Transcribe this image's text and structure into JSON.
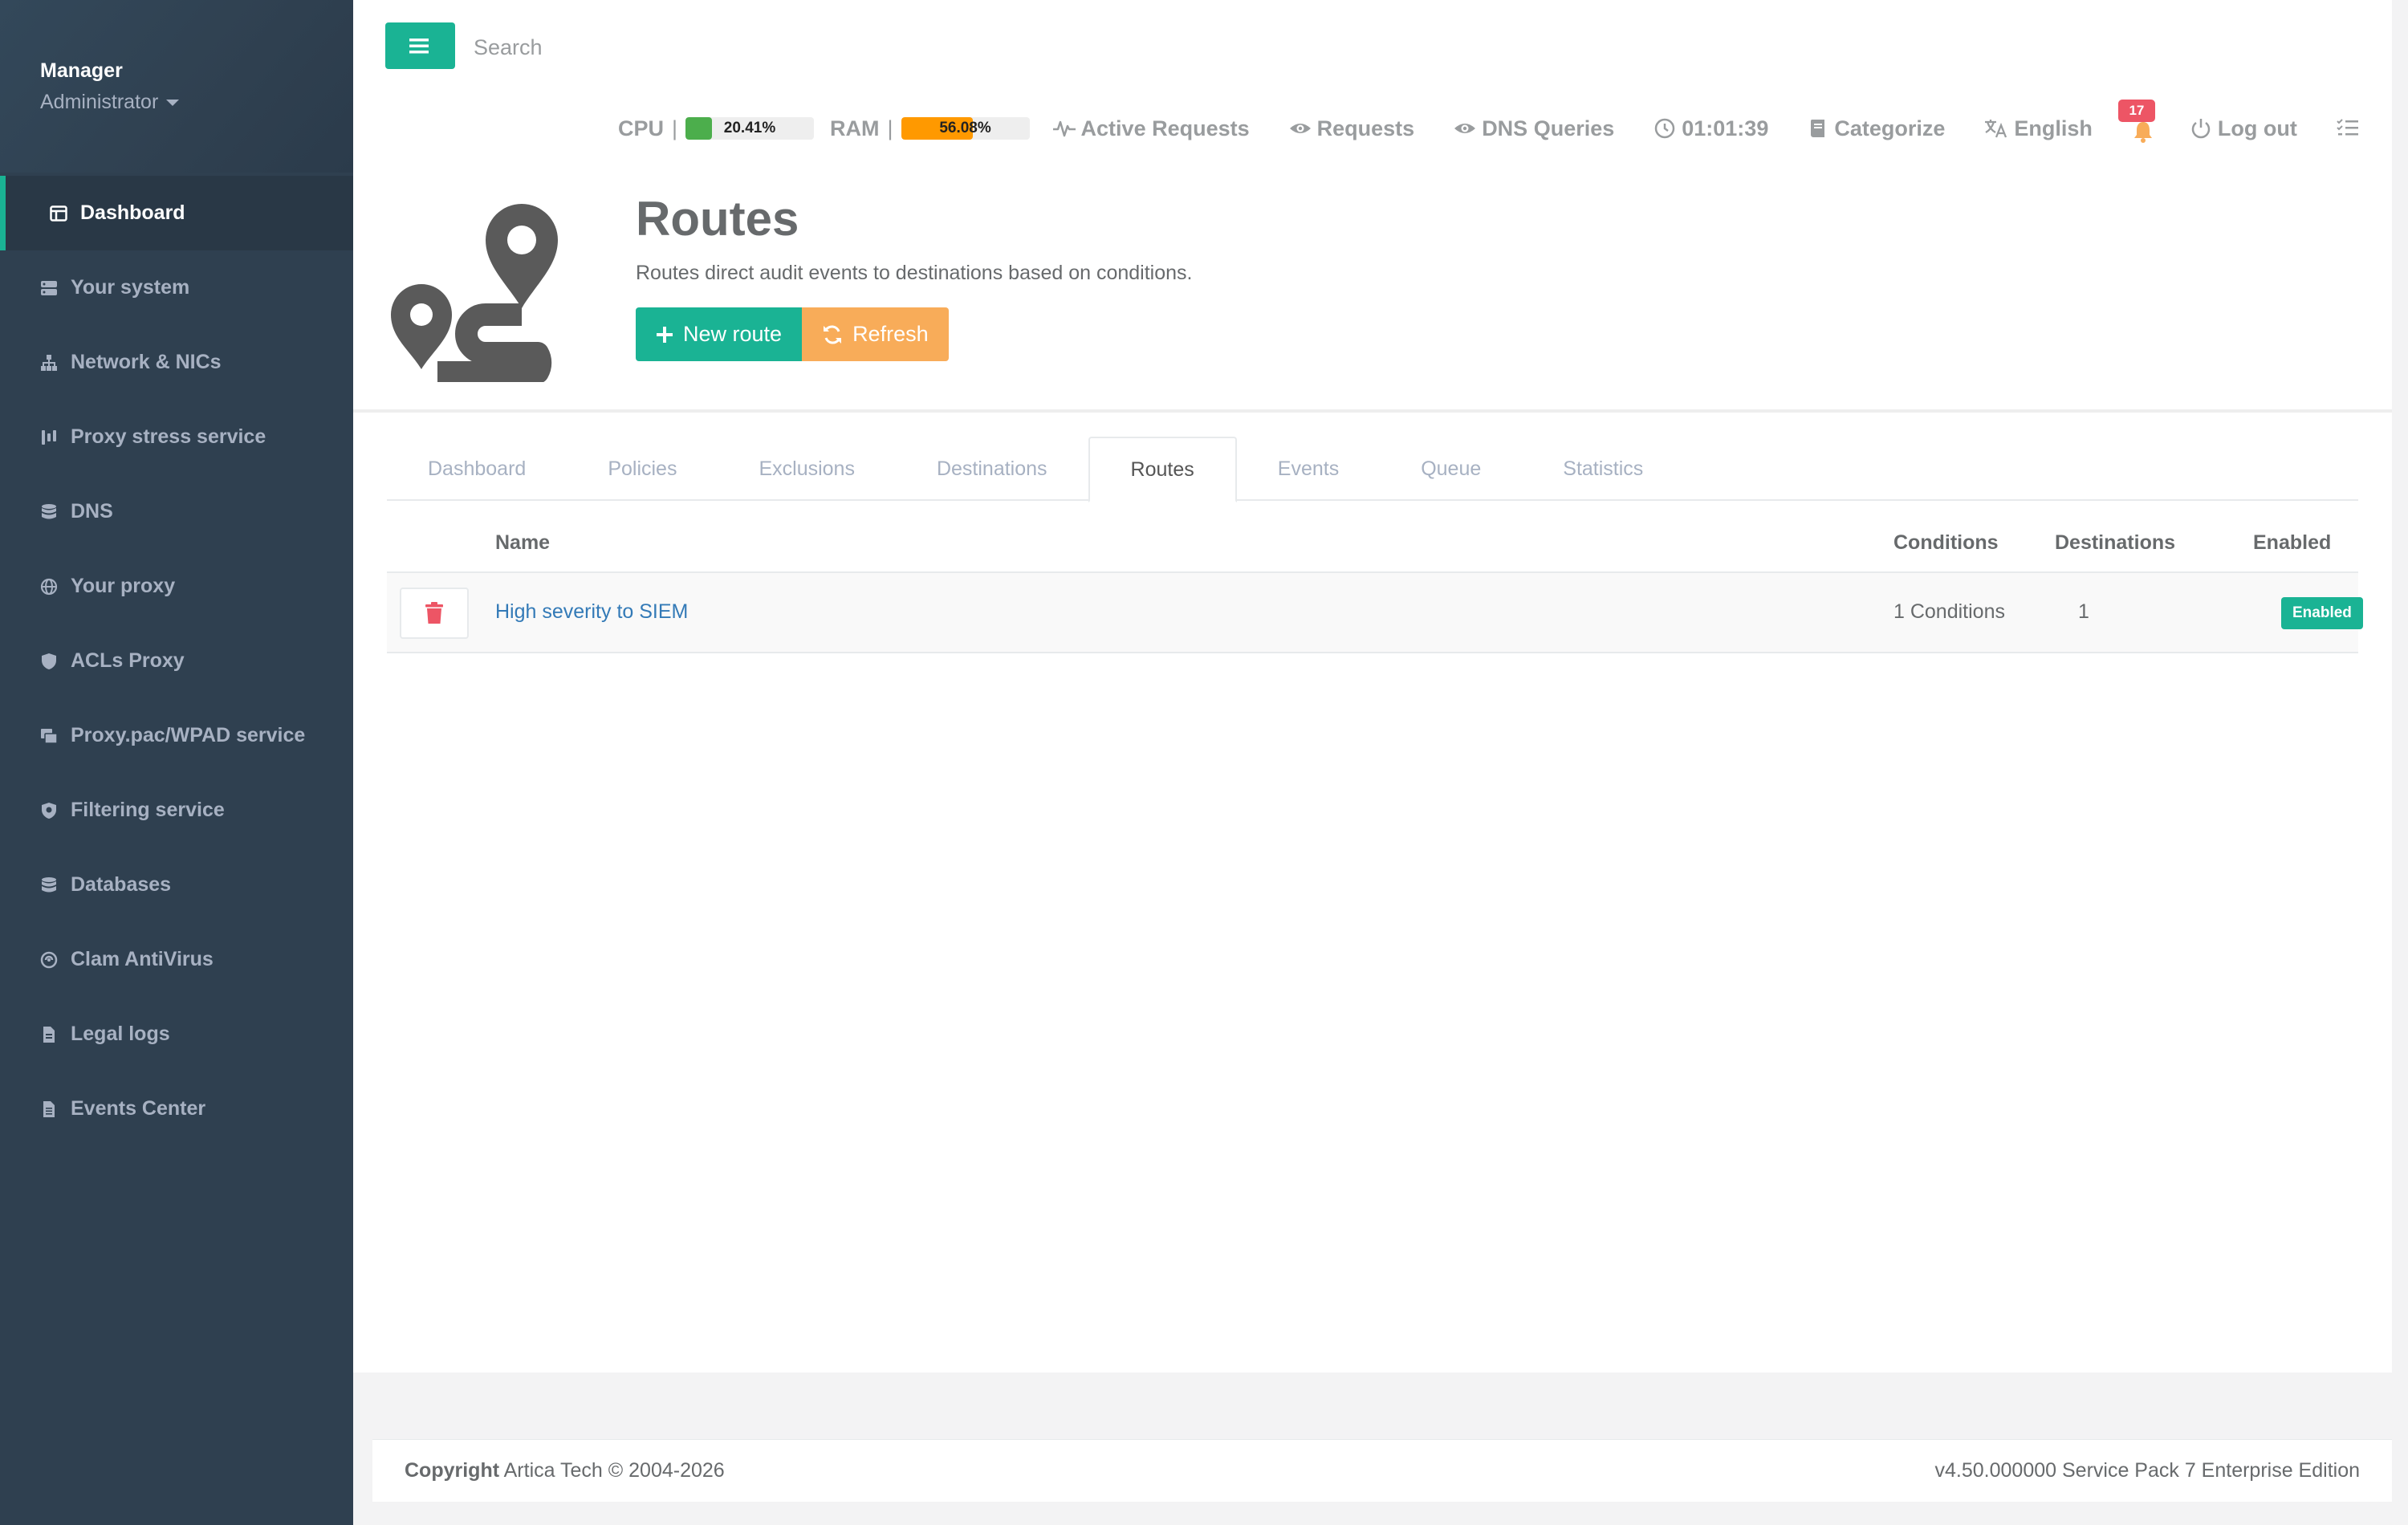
{
  "sidebar": {
    "profile": {
      "name": "Manager",
      "role": "Administrator"
    },
    "items": [
      {
        "label": "Dashboard",
        "icon": "dashboard-icon"
      },
      {
        "label": "Your system",
        "icon": "server-icon"
      },
      {
        "label": "Network & NICs",
        "icon": "network-icon"
      },
      {
        "label": "Proxy stress service",
        "icon": "stress-icon"
      },
      {
        "label": "DNS",
        "icon": "database-icon"
      },
      {
        "label": "Your proxy",
        "icon": "globe-icon"
      },
      {
        "label": "ACLs Proxy",
        "icon": "shield-icon"
      },
      {
        "label": "Proxy.pac/WPAD service",
        "icon": "script-icon"
      },
      {
        "label": "Filtering service",
        "icon": "shield-filter-icon"
      },
      {
        "label": "Databases",
        "icon": "database-icon"
      },
      {
        "label": "Clam AntiVirus",
        "icon": "virus-icon"
      },
      {
        "label": "Legal logs",
        "icon": "file-icon"
      },
      {
        "label": "Events Center",
        "icon": "file-text-icon"
      }
    ]
  },
  "header": {
    "search_placeholder": "Search",
    "cpu_label": "CPU",
    "cpu_value": "20.41%",
    "cpu_percent": 20.41,
    "ram_label": "RAM",
    "ram_value": "56.08%",
    "ram_percent": 56.08,
    "separator": "|",
    "active_requests": "Active Requests",
    "requests": "Requests",
    "dns_queries": "DNS Queries",
    "clock": "01:01:39",
    "categorize": "Categorize",
    "language": "English",
    "notifications_count": "17",
    "logout": "Log out"
  },
  "page": {
    "title": "Routes",
    "subtitle": "Routes direct audit events to destinations based on conditions.",
    "new_route_label": "New route",
    "refresh_label": "Refresh"
  },
  "tabs": [
    {
      "label": "Dashboard",
      "active": false
    },
    {
      "label": "Policies",
      "active": false
    },
    {
      "label": "Exclusions",
      "active": false
    },
    {
      "label": "Destinations",
      "active": false
    },
    {
      "label": "Routes",
      "active": true
    },
    {
      "label": "Events",
      "active": false
    },
    {
      "label": "Queue",
      "active": false
    },
    {
      "label": "Statistics",
      "active": false
    }
  ],
  "table": {
    "columns": {
      "name": "Name",
      "conditions": "Conditions",
      "destinations": "Destinations",
      "enabled": "Enabled"
    },
    "rows": [
      {
        "name": "High severity to SIEM",
        "conditions": "1 Conditions",
        "destinations": "1",
        "enabled": "Enabled"
      }
    ]
  },
  "footer": {
    "copyright_label": "Copyright",
    "copyright_text": "Artica Tech © 2004-2026",
    "version": "v4.50.000000 Service Pack 7 Enterprise Edition"
  },
  "colors": {
    "sidebar_bg": "#2f4050",
    "accent": "#1ab394",
    "warning": "#f8ac59",
    "danger": "#ed5565",
    "cpu_bar": "#4cae4c",
    "ram_bar": "#ff9900"
  }
}
